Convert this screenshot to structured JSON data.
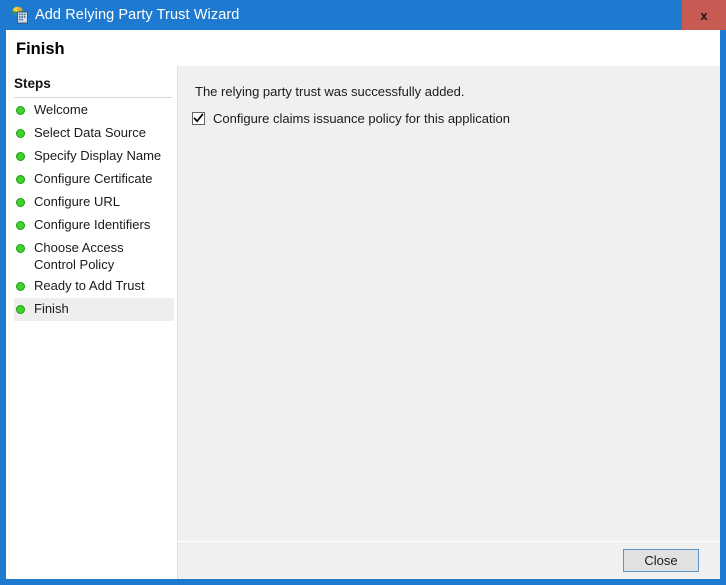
{
  "window": {
    "title": "Add Relying Party Trust Wizard",
    "icon": "relying-party-trust-icon",
    "close_label": "x",
    "accent_color": "#1e7ad1",
    "close_button_color": "#c75b54"
  },
  "header": {
    "page_title": "Finish"
  },
  "sidebar": {
    "header": "Steps",
    "items": [
      {
        "label": "Welcome",
        "state": "completed",
        "selected": false
      },
      {
        "label": "Select Data Source",
        "state": "completed",
        "selected": false
      },
      {
        "label": "Specify Display Name",
        "state": "completed",
        "selected": false
      },
      {
        "label": "Configure Certificate",
        "state": "completed",
        "selected": false
      },
      {
        "label": "Configure URL",
        "state": "completed",
        "selected": false
      },
      {
        "label": "Configure Identifiers",
        "state": "completed",
        "selected": false
      },
      {
        "label": "Choose Access Control Policy",
        "state": "completed",
        "selected": false
      },
      {
        "label": "Ready to Add Trust",
        "state": "completed",
        "selected": false
      },
      {
        "label": "Finish",
        "state": "completed",
        "selected": true
      }
    ],
    "bullet_color": "#3dd32c",
    "selected_background": "#eeeeee"
  },
  "main": {
    "message": "The relying party trust was successfully added.",
    "checkbox": {
      "label": "Configure claims issuance policy for this application",
      "checked": true
    },
    "background_color": "#f0f0f0"
  },
  "footer": {
    "close_label": "Close",
    "close_focused": true
  }
}
